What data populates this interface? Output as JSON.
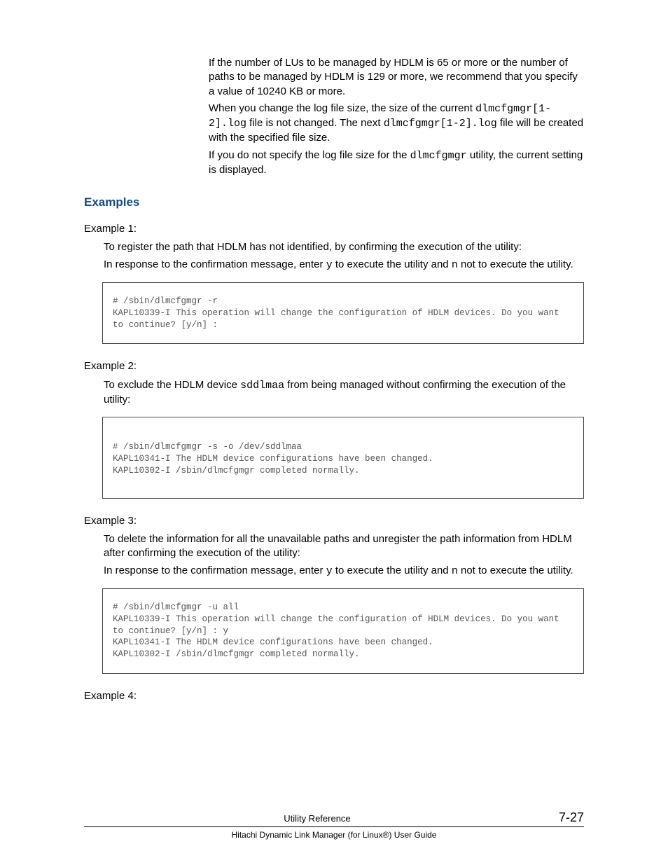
{
  "intro": {
    "p1_a": "If the number of LUs to be managed by HDLM is 65 or more or the number of paths to be managed by HDLM is 129 or more, we recommend that you specify a value of 10240 KB or more.",
    "p2_a": "When you change the log file size, the size of the current ",
    "p2_code1": "dlmcfgmgr[1-2].log",
    "p2_b": " file is not changed. The next ",
    "p2_code2": "dlmcfgmgr[1-2].log",
    "p2_c": " file will be created with the specified file size.",
    "p3_a": "If you do not specify the log file size for the ",
    "p3_code1": "dlmcfgmgr",
    "p3_b": " utility, the current setting is displayed."
  },
  "examples_heading": "Examples",
  "ex1": {
    "label": "Example 1:",
    "desc": "To register the path that HDLM has not identified, by confirming the execution of the utility:",
    "resp_a": "In response to the confirmation message, enter ",
    "resp_y": "y",
    "resp_b": " to execute the utility and ",
    "resp_n": "n",
    "resp_c": " not to execute the utility.",
    "code": "# /sbin/dlmcfgmgr -r\nKAPL10339-I This operation will change the configuration of HDLM devices. Do you want to continue? [y/n] :"
  },
  "ex2": {
    "label": "Example 2:",
    "desc_a": "To exclude the HDLM device ",
    "desc_code": "sddlmaa",
    "desc_b": " from being managed without confirming the execution of the utility:",
    "code": "# /sbin/dlmcfgmgr -s -o /dev/sddlmaa\nKAPL10341-I The HDLM device configurations have been changed.\nKAPL10302-I /sbin/dlmcfgmgr completed normally."
  },
  "ex3": {
    "label": "Example 3:",
    "desc": "To delete the information for all the unavailable paths and unregister the path information from HDLM after confirming the execution of the utility:",
    "resp_a": "In response to the confirmation message, enter ",
    "resp_y": "y",
    "resp_b": " to execute the utility and ",
    "resp_n": "n",
    "resp_c": " not to execute the utility.",
    "code": "# /sbin/dlmcfgmgr -u all\nKAPL10339-I This operation will change the configuration of HDLM devices. Do you want to continue? [y/n] : y\nKAPL10341-I The HDLM device configurations have been changed.\nKAPL10302-I /sbin/dlmcfgmgr completed normally."
  },
  "ex4": {
    "label": "Example 4:"
  },
  "footer": {
    "title": "Utility Reference",
    "pageno": "7-27",
    "subtitle": "Hitachi Dynamic Link Manager (for Linux®) User Guide"
  }
}
